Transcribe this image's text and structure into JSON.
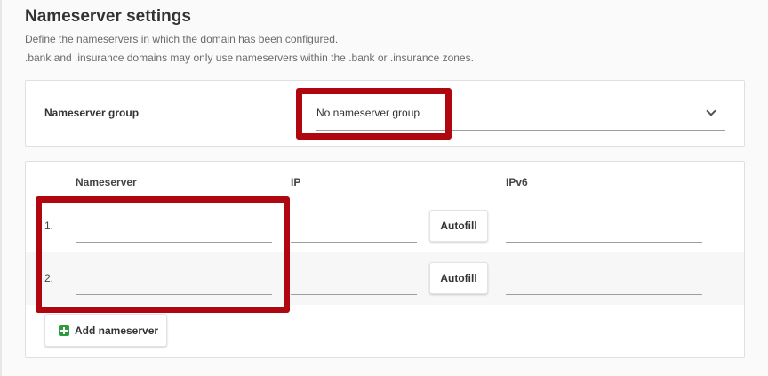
{
  "section": {
    "title": "Nameserver settings",
    "description_1": "Define the nameservers in which the domain has been configured.",
    "description_2": ".bank and .insurance domains may only use nameservers within the .bank or .insurance zones."
  },
  "nameserver_group": {
    "label": "Nameserver group",
    "selected": "No nameserver group"
  },
  "table": {
    "columns": [
      "Nameserver",
      "IP",
      "IPv6"
    ],
    "rows": [
      {
        "index": "1.",
        "nameserver": "",
        "ip": "",
        "ipv6": "",
        "autofill_label": "Autofill"
      },
      {
        "index": "2.",
        "nameserver": "",
        "ip": "",
        "ipv6": "",
        "autofill_label": "Autofill"
      }
    ]
  },
  "add_nameserver_label": "Add nameserver",
  "colors": {
    "highlight": "#b0060f",
    "add_icon": "#2e9b3b"
  },
  "icons": [
    "chevron-down-icon",
    "plus-icon"
  ]
}
